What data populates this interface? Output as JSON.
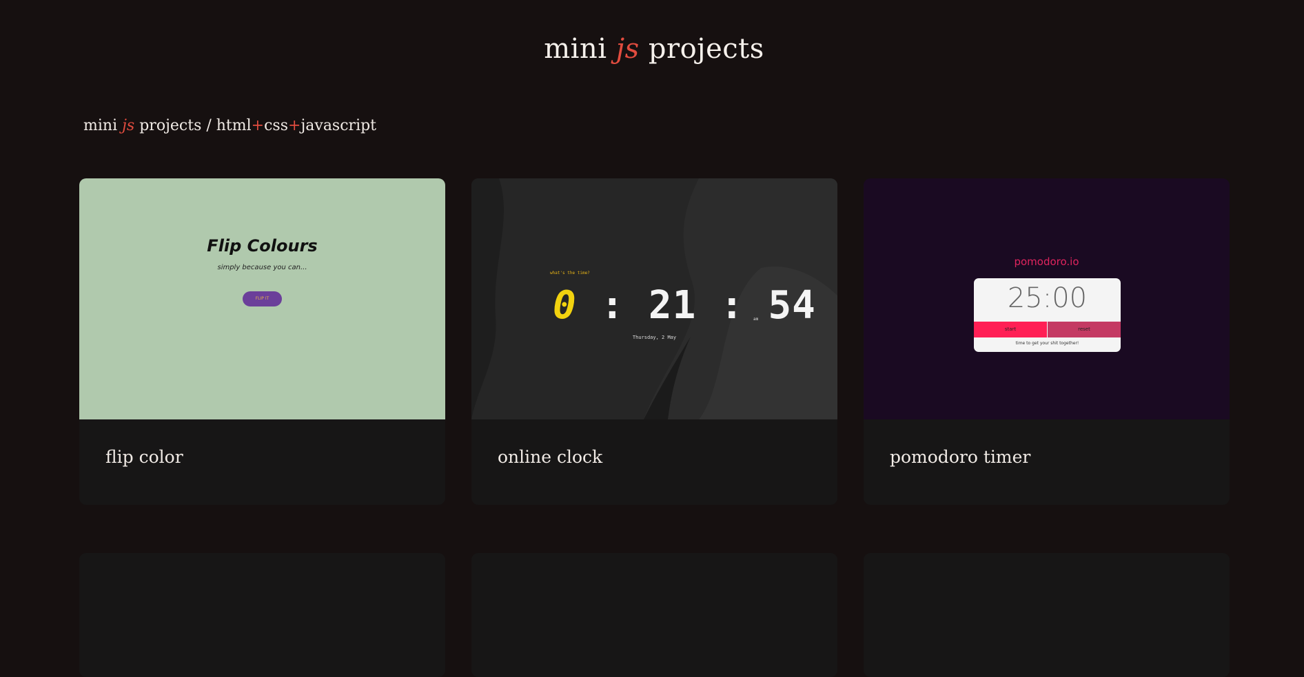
{
  "header": {
    "title_pre": "mini ",
    "title_accent": "js",
    "title_post": " projects"
  },
  "breadcrumb": {
    "pre": "mini ",
    "accent": "js",
    "mid": " projects / html",
    "plus1": "+",
    "css": "css",
    "plus2": "+",
    "js": "javascript"
  },
  "projects": [
    {
      "label": "flip color",
      "preview": {
        "heading": "Flip Colours",
        "subtitle": "simply because you can...",
        "button": "FLIP IT",
        "bg_color": "#b0c9ad",
        "button_color": "#6b3f9a"
      }
    },
    {
      "label": "online clock",
      "preview": {
        "question": "what's the time?",
        "hour": "0",
        "sep1": ":",
        "minutes": "21",
        "sep2": ":",
        "seconds": "54",
        "ampm": "am",
        "date": "Thursday, 2 May",
        "hour_color": "#f2d20f"
      }
    },
    {
      "label": "pomodoro timer",
      "preview": {
        "brand": "pomodoro.io",
        "time": "25:00",
        "start": "start",
        "reset": "reset",
        "tagline": "time to get your shit together!",
        "brand_color": "#e0245e",
        "start_color": "#ff1f55",
        "reset_color": "#c43a63"
      }
    }
  ],
  "colors": {
    "background": "#161010",
    "card": "#171616",
    "accent": "#e24c3f"
  }
}
